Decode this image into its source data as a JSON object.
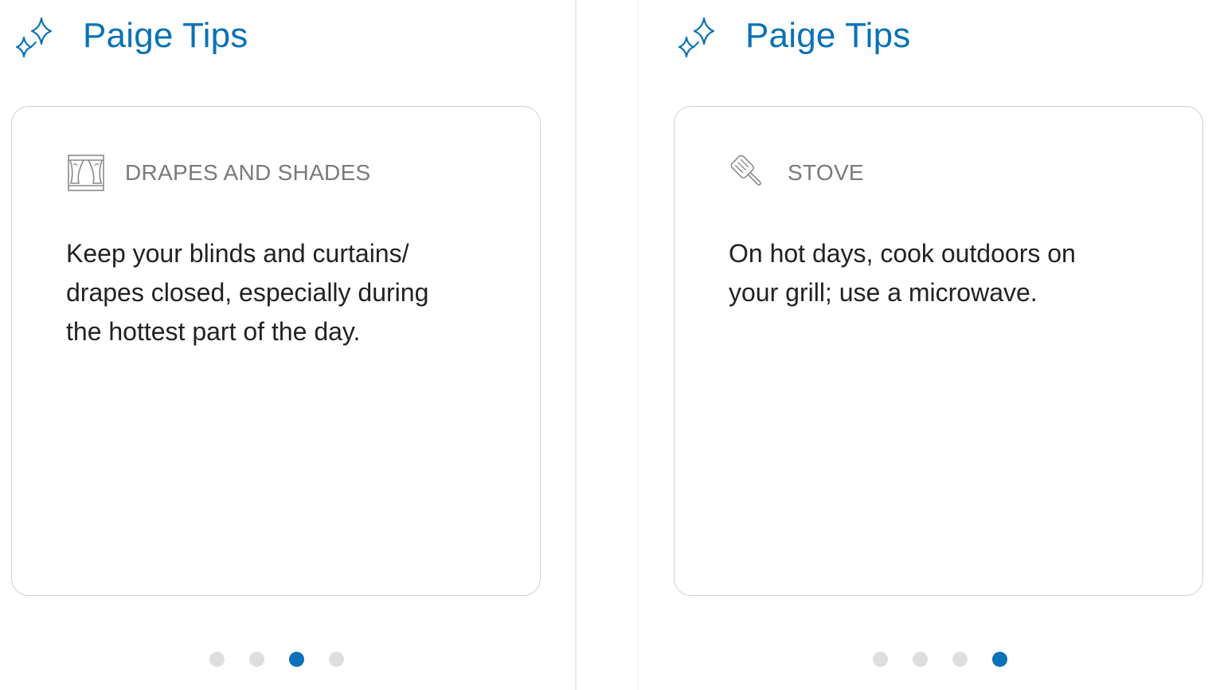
{
  "colors": {
    "accent": "#0a72b6",
    "dot_inactive": "#dedede",
    "card_border": "#cfcfcf",
    "category_text": "#7a7a7a",
    "body_text": "#222222"
  },
  "panels": [
    {
      "header": {
        "title": "Paige Tips",
        "icon": "sparkle-icon"
      },
      "tip": {
        "category": "DRAPES AND SHADES",
        "category_icon": "curtains-icon",
        "text": "Keep your blinds and curtains/ drapes closed, especially during the hottest part of the day."
      },
      "pagination": {
        "total": 4,
        "active_index": 2
      }
    },
    {
      "header": {
        "title": "Paige Tips",
        "icon": "sparkle-icon"
      },
      "tip": {
        "category": "STOVE",
        "category_icon": "spatula-icon",
        "text": "On hot days, cook outdoors on your grill; use a microwave."
      },
      "pagination": {
        "total": 4,
        "active_index": 3
      }
    }
  ]
}
